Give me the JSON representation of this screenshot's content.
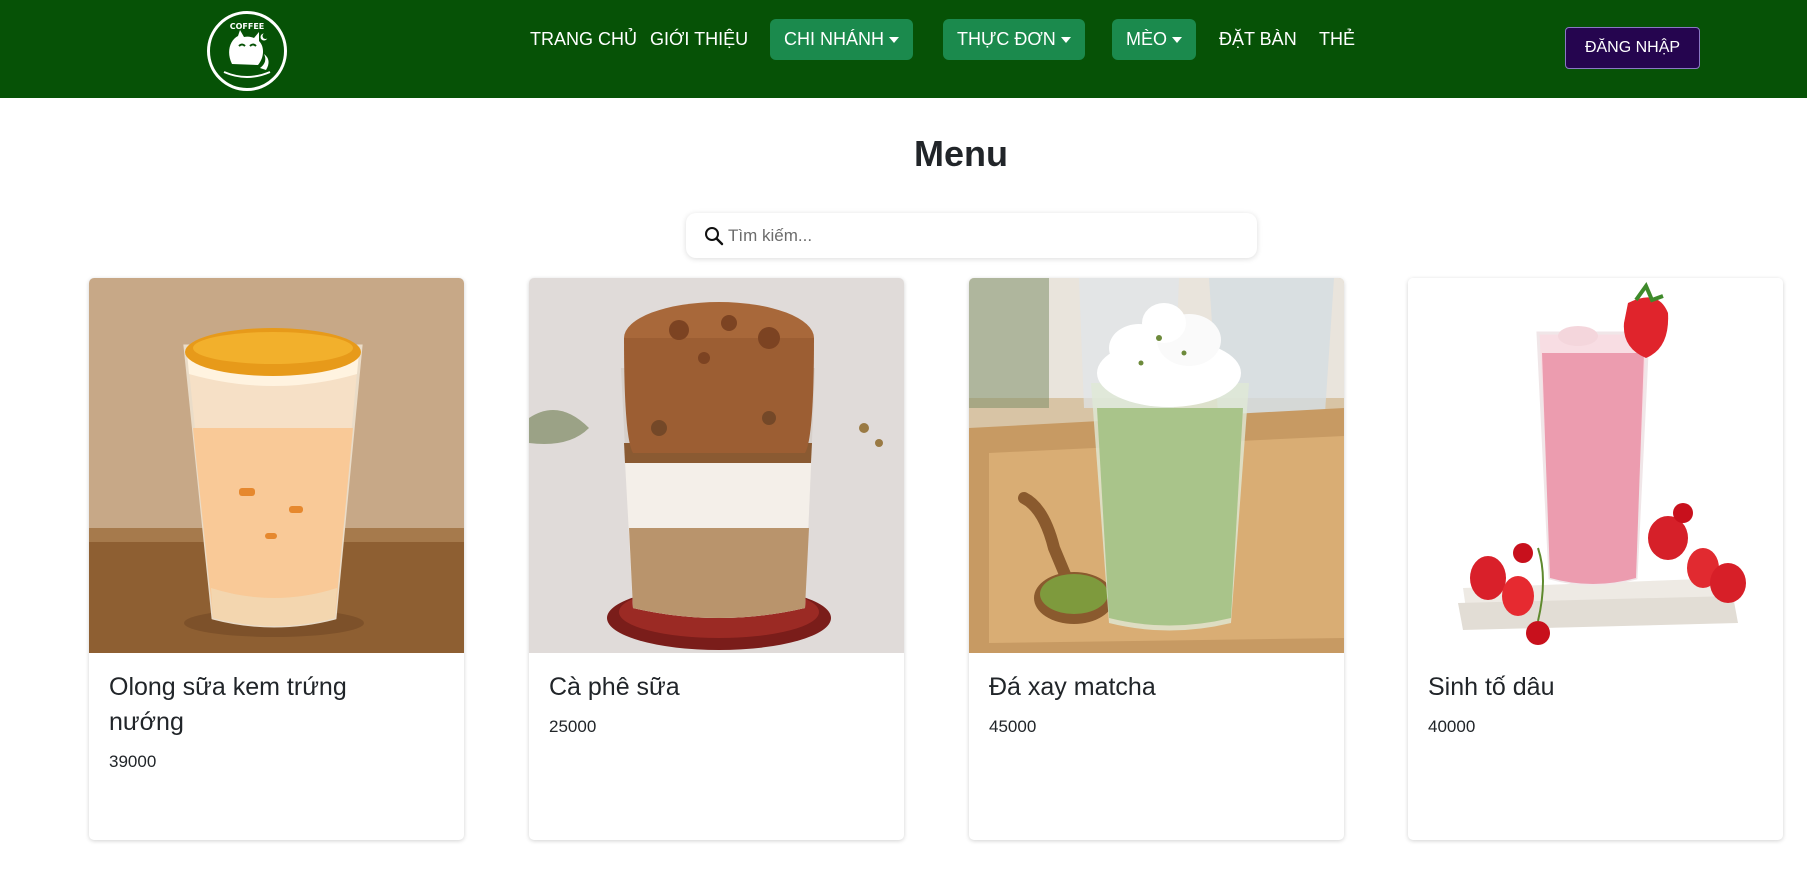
{
  "nav": {
    "logo_icon": "coffee-cat-logo",
    "items": [
      {
        "label": "TRANG CHỦ"
      },
      {
        "label": "GIỚI THIỆU"
      },
      {
        "label": "CHI NHÁNH"
      },
      {
        "label": "THỰC ĐƠN"
      },
      {
        "label": "MÈO"
      },
      {
        "label": "ĐẶT BÀN"
      },
      {
        "label": "THẺ"
      }
    ],
    "login_label": "ĐĂNG NHẬP"
  },
  "page": {
    "title": "Menu"
  },
  "search": {
    "placeholder": "Tìm kiếm...",
    "value": ""
  },
  "products": [
    {
      "name": "Olong sữa kem trứng nướng",
      "price": "39000"
    },
    {
      "name": "Cà phê sữa",
      "price": "25000"
    },
    {
      "name": "Đá xay matcha",
      "price": "45000"
    },
    {
      "name": "Sinh tố dâu",
      "price": "40000"
    }
  ],
  "colors": {
    "navbar": "#065206",
    "nav_pill": "#1b8a4d",
    "login_button": "#25054f"
  }
}
